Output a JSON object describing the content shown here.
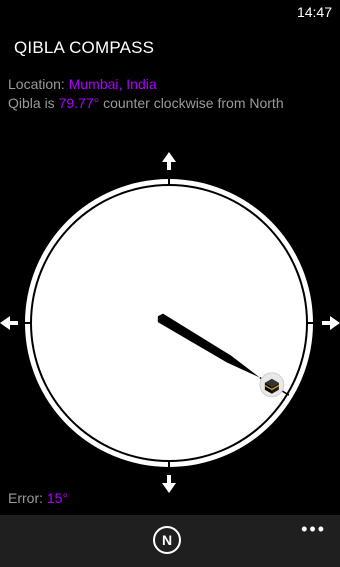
{
  "status_bar": {
    "time": "14:47"
  },
  "app": {
    "title": "QIBLA COMPASS"
  },
  "location": {
    "label": "Location: ",
    "value": "Mumbai, India"
  },
  "qibla": {
    "prefix": "Qibla is ",
    "angle_text": "79.77°",
    "suffix": " counter clockwise from North",
    "needle_heading_deg": 121
  },
  "error": {
    "label": "Error: ",
    "value": "15°"
  },
  "app_bar": {
    "north_label": "N",
    "more_label": "•••"
  },
  "colors": {
    "accent": "#b000ff",
    "background": "#000000",
    "app_bar": "#1f1f1f",
    "secondary_text": "#9a9a9a"
  },
  "icons": {
    "north_arrow": "arrow-up-icon",
    "south_arrow": "arrow-down-icon",
    "west_arrow": "arrow-left-icon",
    "east_arrow": "arrow-right-icon",
    "kaaba": "kaaba-icon"
  }
}
